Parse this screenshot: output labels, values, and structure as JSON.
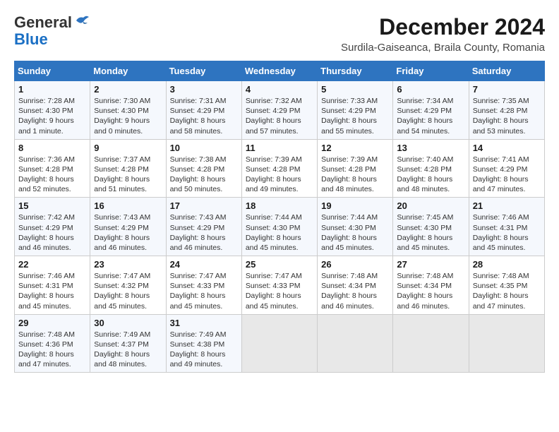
{
  "logo": {
    "general": "General",
    "blue": "Blue"
  },
  "title": {
    "month_year": "December 2024",
    "location": "Surdila-Gaiseanca, Braila County, Romania"
  },
  "weekdays": [
    "Sunday",
    "Monday",
    "Tuesday",
    "Wednesday",
    "Thursday",
    "Friday",
    "Saturday"
  ],
  "weeks": [
    [
      {
        "day": "1",
        "sunrise": "7:28 AM",
        "sunset": "4:30 PM",
        "daylight": "9 hours and 1 minute."
      },
      {
        "day": "2",
        "sunrise": "7:30 AM",
        "sunset": "4:30 PM",
        "daylight": "9 hours and 0 minutes."
      },
      {
        "day": "3",
        "sunrise": "7:31 AM",
        "sunset": "4:29 PM",
        "daylight": "8 hours and 58 minutes."
      },
      {
        "day": "4",
        "sunrise": "7:32 AM",
        "sunset": "4:29 PM",
        "daylight": "8 hours and 57 minutes."
      },
      {
        "day": "5",
        "sunrise": "7:33 AM",
        "sunset": "4:29 PM",
        "daylight": "8 hours and 55 minutes."
      },
      {
        "day": "6",
        "sunrise": "7:34 AM",
        "sunset": "4:29 PM",
        "daylight": "8 hours and 54 minutes."
      },
      {
        "day": "7",
        "sunrise": "7:35 AM",
        "sunset": "4:28 PM",
        "daylight": "8 hours and 53 minutes."
      }
    ],
    [
      {
        "day": "8",
        "sunrise": "7:36 AM",
        "sunset": "4:28 PM",
        "daylight": "8 hours and 52 minutes."
      },
      {
        "day": "9",
        "sunrise": "7:37 AM",
        "sunset": "4:28 PM",
        "daylight": "8 hours and 51 minutes."
      },
      {
        "day": "10",
        "sunrise": "7:38 AM",
        "sunset": "4:28 PM",
        "daylight": "8 hours and 50 minutes."
      },
      {
        "day": "11",
        "sunrise": "7:39 AM",
        "sunset": "4:28 PM",
        "daylight": "8 hours and 49 minutes."
      },
      {
        "day": "12",
        "sunrise": "7:39 AM",
        "sunset": "4:28 PM",
        "daylight": "8 hours and 48 minutes."
      },
      {
        "day": "13",
        "sunrise": "7:40 AM",
        "sunset": "4:28 PM",
        "daylight": "8 hours and 48 minutes."
      },
      {
        "day": "14",
        "sunrise": "7:41 AM",
        "sunset": "4:29 PM",
        "daylight": "8 hours and 47 minutes."
      }
    ],
    [
      {
        "day": "15",
        "sunrise": "7:42 AM",
        "sunset": "4:29 PM",
        "daylight": "8 hours and 46 minutes."
      },
      {
        "day": "16",
        "sunrise": "7:43 AM",
        "sunset": "4:29 PM",
        "daylight": "8 hours and 46 minutes."
      },
      {
        "day": "17",
        "sunrise": "7:43 AM",
        "sunset": "4:29 PM",
        "daylight": "8 hours and 46 minutes."
      },
      {
        "day": "18",
        "sunrise": "7:44 AM",
        "sunset": "4:30 PM",
        "daylight": "8 hours and 45 minutes."
      },
      {
        "day": "19",
        "sunrise": "7:44 AM",
        "sunset": "4:30 PM",
        "daylight": "8 hours and 45 minutes."
      },
      {
        "day": "20",
        "sunrise": "7:45 AM",
        "sunset": "4:30 PM",
        "daylight": "8 hours and 45 minutes."
      },
      {
        "day": "21",
        "sunrise": "7:46 AM",
        "sunset": "4:31 PM",
        "daylight": "8 hours and 45 minutes."
      }
    ],
    [
      {
        "day": "22",
        "sunrise": "7:46 AM",
        "sunset": "4:31 PM",
        "daylight": "8 hours and 45 minutes."
      },
      {
        "day": "23",
        "sunrise": "7:47 AM",
        "sunset": "4:32 PM",
        "daylight": "8 hours and 45 minutes."
      },
      {
        "day": "24",
        "sunrise": "7:47 AM",
        "sunset": "4:33 PM",
        "daylight": "8 hours and 45 minutes."
      },
      {
        "day": "25",
        "sunrise": "7:47 AM",
        "sunset": "4:33 PM",
        "daylight": "8 hours and 45 minutes."
      },
      {
        "day": "26",
        "sunrise": "7:48 AM",
        "sunset": "4:34 PM",
        "daylight": "8 hours and 46 minutes."
      },
      {
        "day": "27",
        "sunrise": "7:48 AM",
        "sunset": "4:34 PM",
        "daylight": "8 hours and 46 minutes."
      },
      {
        "day": "28",
        "sunrise": "7:48 AM",
        "sunset": "4:35 PM",
        "daylight": "8 hours and 47 minutes."
      }
    ],
    [
      {
        "day": "29",
        "sunrise": "7:48 AM",
        "sunset": "4:36 PM",
        "daylight": "8 hours and 47 minutes."
      },
      {
        "day": "30",
        "sunrise": "7:49 AM",
        "sunset": "4:37 PM",
        "daylight": "8 hours and 48 minutes."
      },
      {
        "day": "31",
        "sunrise": "7:49 AM",
        "sunset": "4:38 PM",
        "daylight": "8 hours and 49 minutes."
      },
      null,
      null,
      null,
      null
    ]
  ]
}
